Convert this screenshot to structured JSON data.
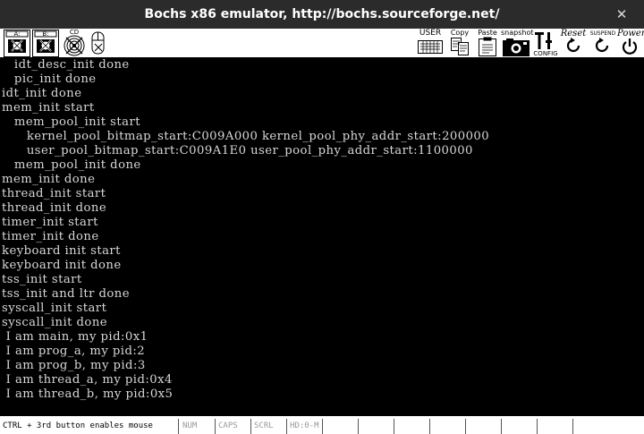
{
  "window": {
    "title": "Bochs x86 emulator, http://bochs.sourceforge.net/",
    "close_glyph": "✕"
  },
  "toolbar": {
    "floppy_a_label": "A:",
    "floppy_b_label": "B:",
    "cdrom_label": "CD",
    "user_label": "USER",
    "copy_label": "Copy",
    "paste_label": "Paste",
    "snapshot_label": "snapshot",
    "config_label": "CONFIG",
    "reset_label": "Reset",
    "suspend_label": "SUSPEND",
    "power_label": "Power"
  },
  "console": {
    "lines": [
      "   idt_desc_init done",
      "   pic_init done",
      "idt_init done",
      "mem_init start",
      "   mem_pool_init start",
      "      kernel_pool_bitmap_start:C009A000 kernel_pool_phy_addr_start:200000",
      "      user_pool_bitmap_start:C009A1E0 user_pool_phy_addr_start:1100000",
      "   mem_pool_init done",
      "mem_init done",
      "thread_init start",
      "thread_init done",
      "timer_init start",
      "timer_init done",
      "keyboard init start",
      "keyboard init done",
      "tss_init start",
      "tss_init and ltr done",
      "syscall_init start",
      "syscall_init done",
      " I am main, my pid:0x1",
      " I am prog_a, my pid:2",
      " I am prog_b, my pid:3",
      " I am thread_a, my pid:0x4",
      " I am thread_b, my pid:0x5"
    ]
  },
  "statusbar": {
    "mouse_hint": "CTRL + 3rd button enables mouse",
    "num": "NUM",
    "caps": "CAPS",
    "scrl": "SCRL",
    "hd": "HD:0-M"
  }
}
